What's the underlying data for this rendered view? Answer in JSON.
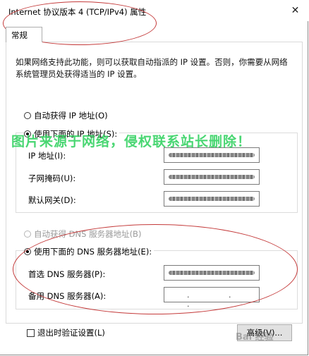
{
  "window": {
    "title": "Internet 协议版本 4 (TCP/IPv4) 属性",
    "close_glyph": "✕"
  },
  "tabs": [
    {
      "label": "常规",
      "selected": true
    }
  ],
  "description": "如果网络支持此功能，则可以获取自动指派的 IP 设置。否则，你需要从网络系统管理员处获得适当的 IP 设置。",
  "ip_section": {
    "auto_label": "自动获得 IP 地址(O)",
    "manual_label": "使用下面的 IP 地址(S):",
    "manual_selected": true,
    "fields": [
      {
        "label": "IP 地址(I):"
      },
      {
        "label": "子网掩码(U):"
      },
      {
        "label": "默认网关(D):"
      }
    ]
  },
  "dns_section": {
    "auto_label": "自动获得 DNS 服务器地址(B)",
    "manual_label": "使用下面的 DNS 服务器地址(E):",
    "manual_selected": true,
    "preferred_label": "首选 DNS 服务器(P):",
    "alternate_label": "备用 DNS 服务器(A):",
    "alternate_value": ". . ."
  },
  "validate_checkbox": {
    "label": "退出时验证设置(L)",
    "checked": false
  },
  "advanced_button": {
    "label": "高级(V)..."
  },
  "watermark": {
    "text": "图片来源于网络，侵权联系站长删除！"
  },
  "brand_watermark": {
    "text": "Bai 经验"
  },
  "colors": {
    "watermark": "#2ad05a",
    "annotation": "#c43a3a"
  },
  "icons": {
    "close": "close-icon",
    "radio": "radio-button-icon",
    "checkbox": "checkbox-icon"
  }
}
